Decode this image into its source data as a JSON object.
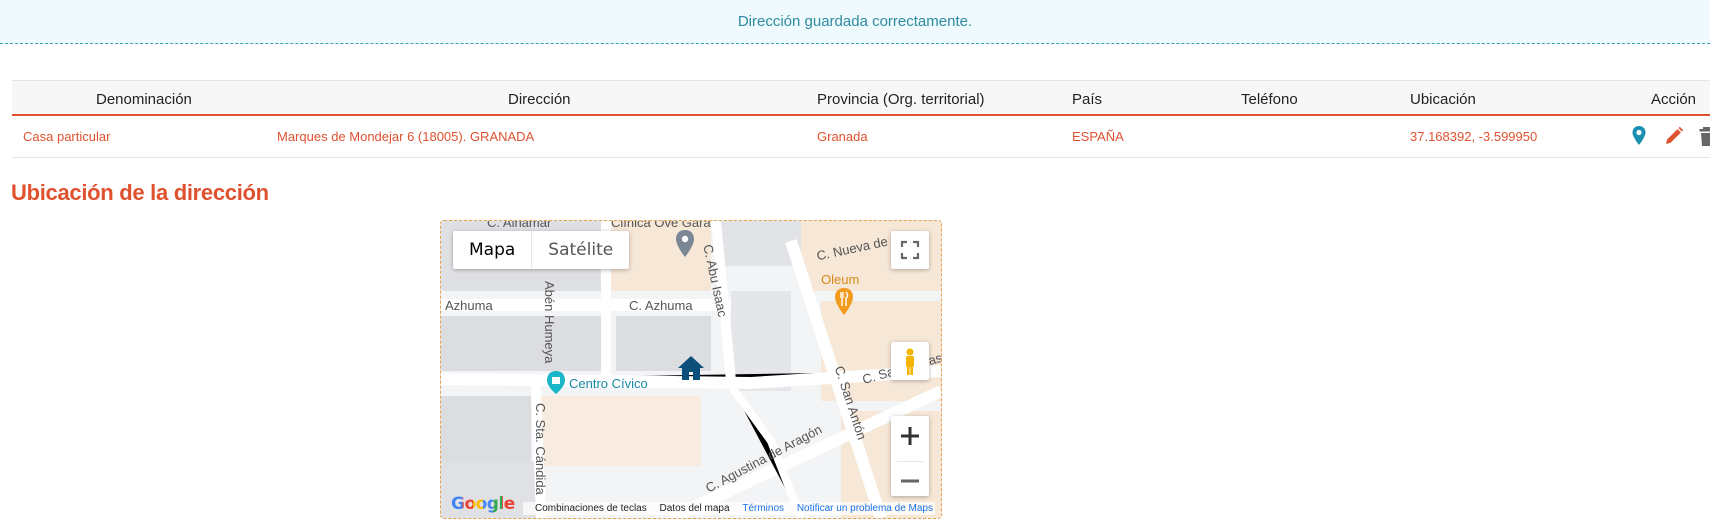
{
  "banner": {
    "message": "Dirección guardada correctamente."
  },
  "table": {
    "headers": [
      "Denominación",
      "Dirección",
      "Provincia (Org. territorial)",
      "País",
      "Teléfono",
      "Ubicación",
      "Acción"
    ],
    "rows": [
      {
        "denominacion": "Casa particular",
        "direccion": "Marques de Mondejar 6 (18005). GRANADA",
        "provincia": "Granada",
        "pais": "ESPAÑA",
        "telefono": "",
        "ubicacion": "37.168392, -3.599950"
      }
    ]
  },
  "section": {
    "title": "Ubicación de la dirección"
  },
  "map": {
    "type_buttons": [
      "Mapa",
      "Satélite"
    ],
    "active_type": "Mapa",
    "labels": {
      "alhamar": "C. Alhamar",
      "clinica": "Clínica Ove Gara",
      "azhuma_left": "Azhuma",
      "azhuma": "C. Azhuma",
      "aben_humeya": "Abén Humeya",
      "abu_isaac": "C. Abu Isaac",
      "nueva": "C. Nueva de",
      "oleum": "Oleum",
      "centro_civico": "Centro Cívico",
      "san_anton": "C. San Antón",
      "san_matias": "C. San Matías",
      "sta_candida": "C. Sta. Cándida",
      "agustina": "C. Agustina de Aragón"
    },
    "footer": {
      "logo": "Google",
      "keyboard": "Combinaciones de teclas",
      "data": "Datos del mapa",
      "terms": "Términos",
      "report": "Notificar un problema de Maps"
    }
  },
  "colors": {
    "accent": "#e0522f",
    "banner_text": "#2f8aa0",
    "pin": "#1b8fb0",
    "marker": "#0b4f7a"
  },
  "icons": [
    "map-pin-icon",
    "pencil-icon",
    "trash-icon",
    "fullscreen-icon",
    "pegman-icon",
    "home-marker-icon",
    "restaurant-icon",
    "civic-center-icon"
  ]
}
